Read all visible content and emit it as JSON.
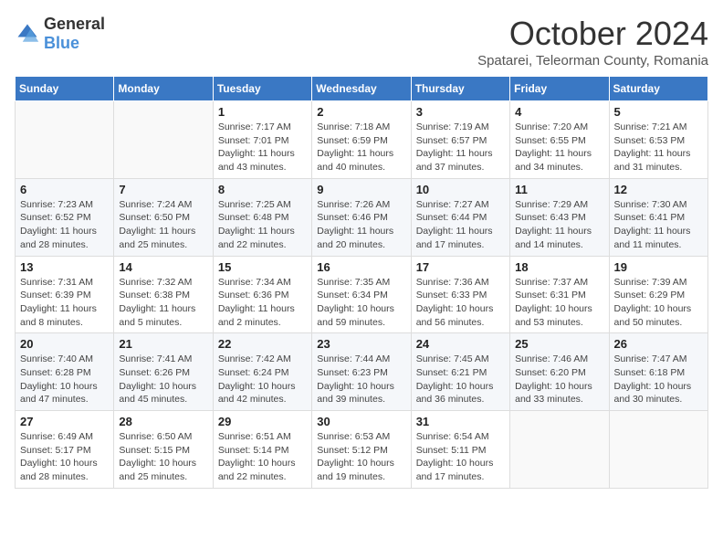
{
  "header": {
    "logo_general": "General",
    "logo_blue": "Blue",
    "month_title": "October 2024",
    "subtitle": "Spatarei, Teleorman County, Romania"
  },
  "weekdays": [
    "Sunday",
    "Monday",
    "Tuesday",
    "Wednesday",
    "Thursday",
    "Friday",
    "Saturday"
  ],
  "weeks": [
    [
      {
        "day": "",
        "info": ""
      },
      {
        "day": "",
        "info": ""
      },
      {
        "day": "1",
        "info": "Sunrise: 7:17 AM\nSunset: 7:01 PM\nDaylight: 11 hours and 43 minutes."
      },
      {
        "day": "2",
        "info": "Sunrise: 7:18 AM\nSunset: 6:59 PM\nDaylight: 11 hours and 40 minutes."
      },
      {
        "day": "3",
        "info": "Sunrise: 7:19 AM\nSunset: 6:57 PM\nDaylight: 11 hours and 37 minutes."
      },
      {
        "day": "4",
        "info": "Sunrise: 7:20 AM\nSunset: 6:55 PM\nDaylight: 11 hours and 34 minutes."
      },
      {
        "day": "5",
        "info": "Sunrise: 7:21 AM\nSunset: 6:53 PM\nDaylight: 11 hours and 31 minutes."
      }
    ],
    [
      {
        "day": "6",
        "info": "Sunrise: 7:23 AM\nSunset: 6:52 PM\nDaylight: 11 hours and 28 minutes."
      },
      {
        "day": "7",
        "info": "Sunrise: 7:24 AM\nSunset: 6:50 PM\nDaylight: 11 hours and 25 minutes."
      },
      {
        "day": "8",
        "info": "Sunrise: 7:25 AM\nSunset: 6:48 PM\nDaylight: 11 hours and 22 minutes."
      },
      {
        "day": "9",
        "info": "Sunrise: 7:26 AM\nSunset: 6:46 PM\nDaylight: 11 hours and 20 minutes."
      },
      {
        "day": "10",
        "info": "Sunrise: 7:27 AM\nSunset: 6:44 PM\nDaylight: 11 hours and 17 minutes."
      },
      {
        "day": "11",
        "info": "Sunrise: 7:29 AM\nSunset: 6:43 PM\nDaylight: 11 hours and 14 minutes."
      },
      {
        "day": "12",
        "info": "Sunrise: 7:30 AM\nSunset: 6:41 PM\nDaylight: 11 hours and 11 minutes."
      }
    ],
    [
      {
        "day": "13",
        "info": "Sunrise: 7:31 AM\nSunset: 6:39 PM\nDaylight: 11 hours and 8 minutes."
      },
      {
        "day": "14",
        "info": "Sunrise: 7:32 AM\nSunset: 6:38 PM\nDaylight: 11 hours and 5 minutes."
      },
      {
        "day": "15",
        "info": "Sunrise: 7:34 AM\nSunset: 6:36 PM\nDaylight: 11 hours and 2 minutes."
      },
      {
        "day": "16",
        "info": "Sunrise: 7:35 AM\nSunset: 6:34 PM\nDaylight: 10 hours and 59 minutes."
      },
      {
        "day": "17",
        "info": "Sunrise: 7:36 AM\nSunset: 6:33 PM\nDaylight: 10 hours and 56 minutes."
      },
      {
        "day": "18",
        "info": "Sunrise: 7:37 AM\nSunset: 6:31 PM\nDaylight: 10 hours and 53 minutes."
      },
      {
        "day": "19",
        "info": "Sunrise: 7:39 AM\nSunset: 6:29 PM\nDaylight: 10 hours and 50 minutes."
      }
    ],
    [
      {
        "day": "20",
        "info": "Sunrise: 7:40 AM\nSunset: 6:28 PM\nDaylight: 10 hours and 47 minutes."
      },
      {
        "day": "21",
        "info": "Sunrise: 7:41 AM\nSunset: 6:26 PM\nDaylight: 10 hours and 45 minutes."
      },
      {
        "day": "22",
        "info": "Sunrise: 7:42 AM\nSunset: 6:24 PM\nDaylight: 10 hours and 42 minutes."
      },
      {
        "day": "23",
        "info": "Sunrise: 7:44 AM\nSunset: 6:23 PM\nDaylight: 10 hours and 39 minutes."
      },
      {
        "day": "24",
        "info": "Sunrise: 7:45 AM\nSunset: 6:21 PM\nDaylight: 10 hours and 36 minutes."
      },
      {
        "day": "25",
        "info": "Sunrise: 7:46 AM\nSunset: 6:20 PM\nDaylight: 10 hours and 33 minutes."
      },
      {
        "day": "26",
        "info": "Sunrise: 7:47 AM\nSunset: 6:18 PM\nDaylight: 10 hours and 30 minutes."
      }
    ],
    [
      {
        "day": "27",
        "info": "Sunrise: 6:49 AM\nSunset: 5:17 PM\nDaylight: 10 hours and 28 minutes."
      },
      {
        "day": "28",
        "info": "Sunrise: 6:50 AM\nSunset: 5:15 PM\nDaylight: 10 hours and 25 minutes."
      },
      {
        "day": "29",
        "info": "Sunrise: 6:51 AM\nSunset: 5:14 PM\nDaylight: 10 hours and 22 minutes."
      },
      {
        "day": "30",
        "info": "Sunrise: 6:53 AM\nSunset: 5:12 PM\nDaylight: 10 hours and 19 minutes."
      },
      {
        "day": "31",
        "info": "Sunrise: 6:54 AM\nSunset: 5:11 PM\nDaylight: 10 hours and 17 minutes."
      },
      {
        "day": "",
        "info": ""
      },
      {
        "day": "",
        "info": ""
      }
    ]
  ]
}
